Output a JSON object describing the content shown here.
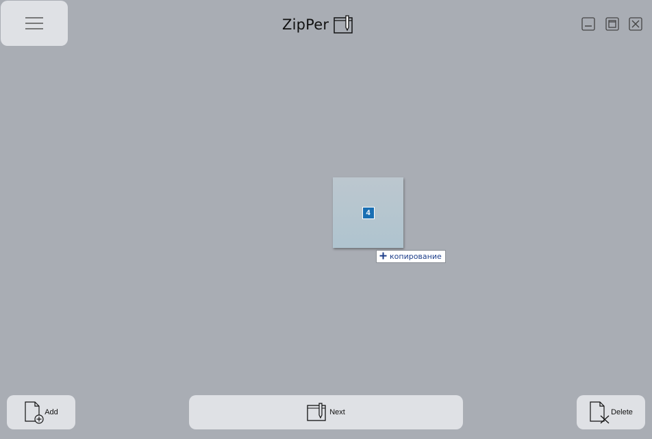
{
  "header": {
    "title": "ZipPer",
    "menu_icon": "hamburger-icon",
    "title_icon": "notebook-pen-icon",
    "window_controls": [
      "minimize-icon",
      "maximize-icon",
      "close-icon"
    ]
  },
  "canvas": {
    "drag_tile": {
      "page_number": "4"
    },
    "drop_hint": {
      "icon": "plus-icon",
      "label": "копирование"
    }
  },
  "footer": {
    "add_label": "Add",
    "add_icon": "file-add-icon",
    "next_label": "Next",
    "next_icon": "notebook-pen-icon",
    "delete_label": "Delete",
    "delete_icon": "file-delete-icon"
  },
  "colors": {
    "background": "#a9adb4",
    "button": "#dfe1e5",
    "badge": "#1a6fb3",
    "hint_text": "#1d3e8a"
  }
}
